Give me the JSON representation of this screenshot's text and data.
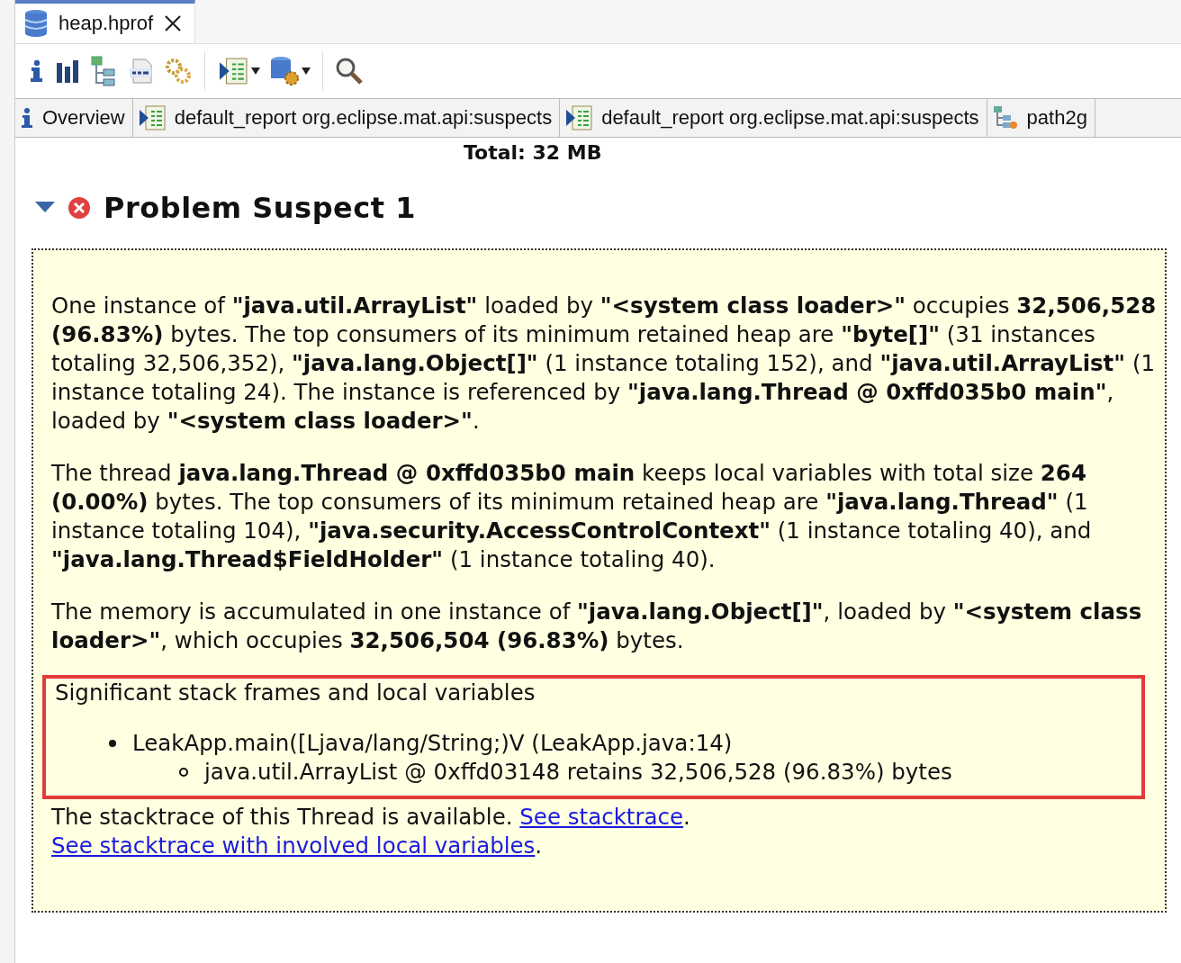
{
  "editor_tab": {
    "title": "heap.hprof",
    "selected": true
  },
  "report_tabs": [
    {
      "kind": "info",
      "label": "Overview"
    },
    {
      "kind": "report",
      "label": "default_report org.eclipse.mat.api:suspects"
    },
    {
      "kind": "report",
      "label": "default_report org.eclipse.mat.api:suspects"
    },
    {
      "kind": "tree",
      "label": "path2g"
    }
  ],
  "report": {
    "total": "Total: 32 MB",
    "suspect": {
      "title": "Problem Suspect 1",
      "expanded": true,
      "paragraphs": [
        "One instance of **\"java.util.ArrayList\"** loaded by **\"<system class loader>\"** occupies **32,506,528 (96.83%)** bytes. The top consumers of its minimum retained heap are **\"byte[]\"** (31 instances totaling 32,506,352), **\"java.lang.Object[]\"** (1 instance totaling 152), and **\"java.util.ArrayList\"** (1 instance totaling 24). The instance is referenced by **\"java.lang.Thread @ 0xffd035b0 main\"**, loaded by **\"<system class loader>\"**.",
        "The thread **java.lang.Thread @ 0xffd035b0 main** keeps local variables with total size **264 (0.00%)** bytes. The top consumers of its minimum retained heap are **\"java.lang.Thread\"** (1 instance totaling 104), **\"java.security.AccessControlContext\"** (1 instance totaling 40), and **\"java.lang.Thread$FieldHolder\"** (1 instance totaling 40).",
        "The memory is accumulated in one instance of **\"java.lang.Object[]\"**, loaded by **\"<system class loader>\"**, which occupies **32,506,504 (96.83%)** bytes."
      ],
      "highlight": {
        "title": "Significant stack frames and local variables",
        "items": [
          {
            "text": "LeakApp.main([Ljava/lang/String;)V (LeakApp.java:14)",
            "children": [
              {
                "text": "java.util.ArrayList @ 0xffd03148 retains 32,506,528 (96.83%) bytes"
              }
            ]
          }
        ]
      },
      "footer": [
        {
          "kind": "text",
          "text": "The stacktrace of this Thread is available. "
        },
        {
          "kind": "link",
          "text": "See stacktrace"
        },
        {
          "kind": "text",
          "text": ". "
        },
        {
          "kind": "link",
          "text": "See stacktrace with involved local variables"
        },
        {
          "kind": "text",
          "text": "."
        }
      ]
    }
  }
}
